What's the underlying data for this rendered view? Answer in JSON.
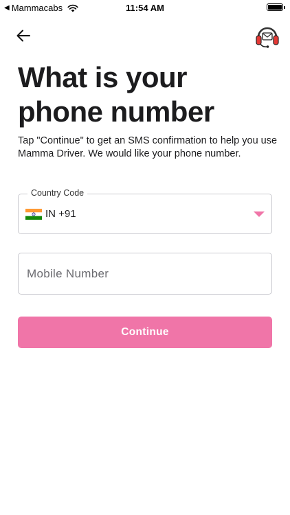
{
  "status_bar": {
    "back_glyph": "◀",
    "carrier": "Mammacabs",
    "time": "11:54 AM",
    "icons": [
      "wifi-icon",
      "battery-icon"
    ]
  },
  "header": {
    "back_icon": "arrow-left-icon",
    "support_icon": "headset-support-icon"
  },
  "main": {
    "title": "What is your phone number",
    "subtitle": "Tap \"Continue\" to get an SMS confirmation to help you use Mamma Driver. We would like your phone number."
  },
  "form": {
    "country_code": {
      "label": "Country Code",
      "value": "IN +91",
      "flag_icon": "india-flag-icon",
      "caret_icon": "caret-down-icon"
    },
    "mobile": {
      "value": "",
      "placeholder": "Mobile Number"
    },
    "continue_label": "Continue"
  },
  "colors": {
    "accent": "#f075a8",
    "border": "#c9c9cf",
    "text": "#1c1c1e"
  }
}
